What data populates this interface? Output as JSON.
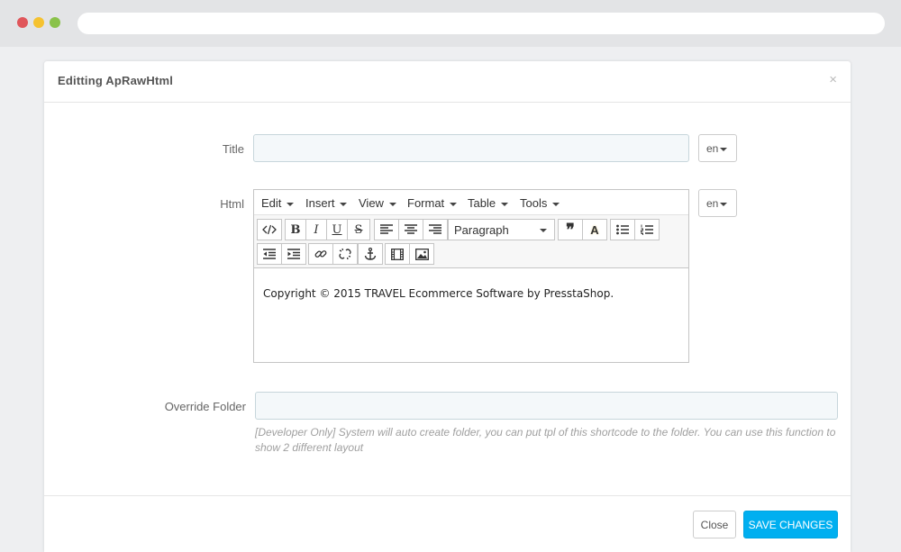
{
  "modal": {
    "title": "Editting ApRawHtml",
    "close_glyph": "×"
  },
  "form": {
    "title_label": "Title",
    "title_value": "",
    "html_label": "Html",
    "override_label": "Override Folder",
    "override_value": "",
    "override_help": "[Developer Only] System will auto create folder, you can put tpl of this shortcode to the folder. You can use this function to show 2 different layout",
    "lang_title": "en",
    "lang_html": "en"
  },
  "editor": {
    "menus": [
      "Edit",
      "Insert",
      "View",
      "Format",
      "Table",
      "Tools"
    ],
    "block_format": "Paragraph",
    "content": "Copyright © 2015 TRAVEL Ecommerce Software by PresstaShop.",
    "buttons": {
      "bold": "B",
      "italic": "I",
      "underline": "U",
      "strike": "S",
      "font_color": "A",
      "quote": "❞"
    }
  },
  "footer": {
    "close_label": "Close",
    "save_label": "SAVE CHANGES"
  },
  "colors": {
    "accent": "#00aff0",
    "input_bg": "#f4f8fa"
  }
}
